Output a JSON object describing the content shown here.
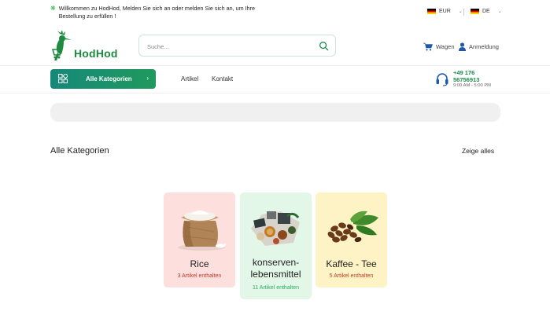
{
  "topbar": {
    "welcome": "Willkommen zu HodHod, Melden Sie sich an oder melden Sie sich an, um Ihre Bestellung zu erfüllen !",
    "currency": "EUR",
    "language": "DE"
  },
  "header": {
    "brand": "HodHod",
    "search_placeholder": "Suche...",
    "cart_label": "Wagen",
    "login_label": "Anmeldung"
  },
  "nav": {
    "categories_button": "Alle Kategorien",
    "links": [
      "Artikel",
      "Kontakt"
    ],
    "phone_line1": "+49 176",
    "phone_line2": "56756913",
    "hours": "9:00 AM - 5:00 PM"
  },
  "section": {
    "title": "Alle Kategorien",
    "show_all": "Zeige alles"
  },
  "categories": [
    {
      "name": "Rice",
      "count": "3 Artikel enthalten",
      "bg": "#fde0dd",
      "count_color": "#c0392b"
    },
    {
      "name_line1": "konserven-",
      "name_line2": "lebensmittel",
      "count": "11 Artikel enthalten",
      "bg": "#e3f7e9",
      "count_color": "#27ae60"
    },
    {
      "name": "Kaffee - Tee",
      "count": "5 Artikel enthalten",
      "bg": "#fdf3c4",
      "count_color": "#c0392b"
    }
  ],
  "colors": {
    "brand_green": "#1d8a3f",
    "accent_teal": "#16887a"
  },
  "icons": [
    "leaf-icon",
    "flag-de-icon",
    "search-icon",
    "cart-icon",
    "user-icon",
    "grid-icon",
    "chevron-right-icon",
    "headset-icon"
  ]
}
